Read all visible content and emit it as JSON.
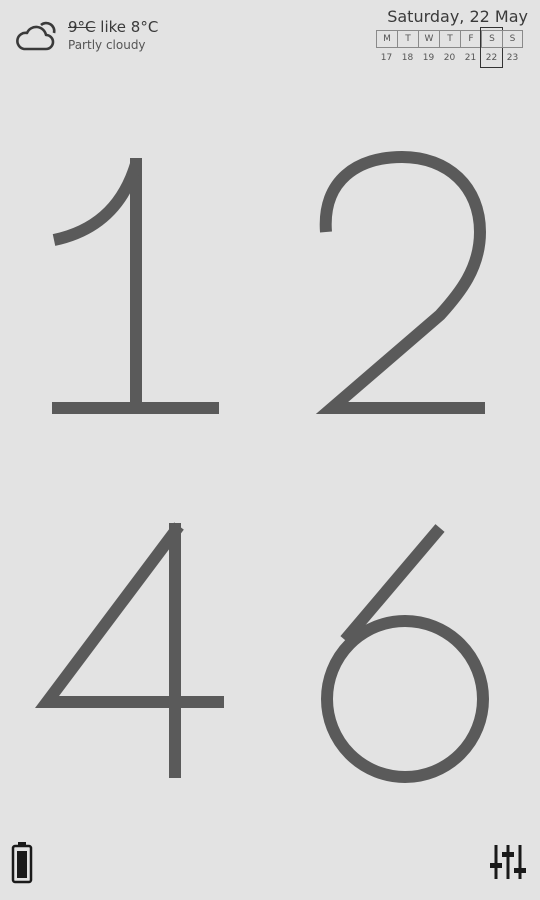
{
  "weather": {
    "icon": "partly-cloudy-icon",
    "temperature": "9°C",
    "feels_like": " like 8°C",
    "condition": "Partly cloudy"
  },
  "date": {
    "label": "Saturday, 22 May",
    "days": [
      {
        "name": "M",
        "num": "17"
      },
      {
        "name": "T",
        "num": "18"
      },
      {
        "name": "W",
        "num": "19"
      },
      {
        "name": "T",
        "num": "20"
      },
      {
        "name": "F",
        "num": "21"
      },
      {
        "name": "S",
        "num": "22",
        "today": true
      },
      {
        "name": "S",
        "num": "23"
      }
    ]
  },
  "clock": {
    "hour_tens": "1",
    "hour_ones": "2",
    "minute_tens": "4",
    "minute_ones": "6"
  },
  "colors": {
    "background": "#e3e3e3",
    "digits": "#5a5a5a"
  }
}
